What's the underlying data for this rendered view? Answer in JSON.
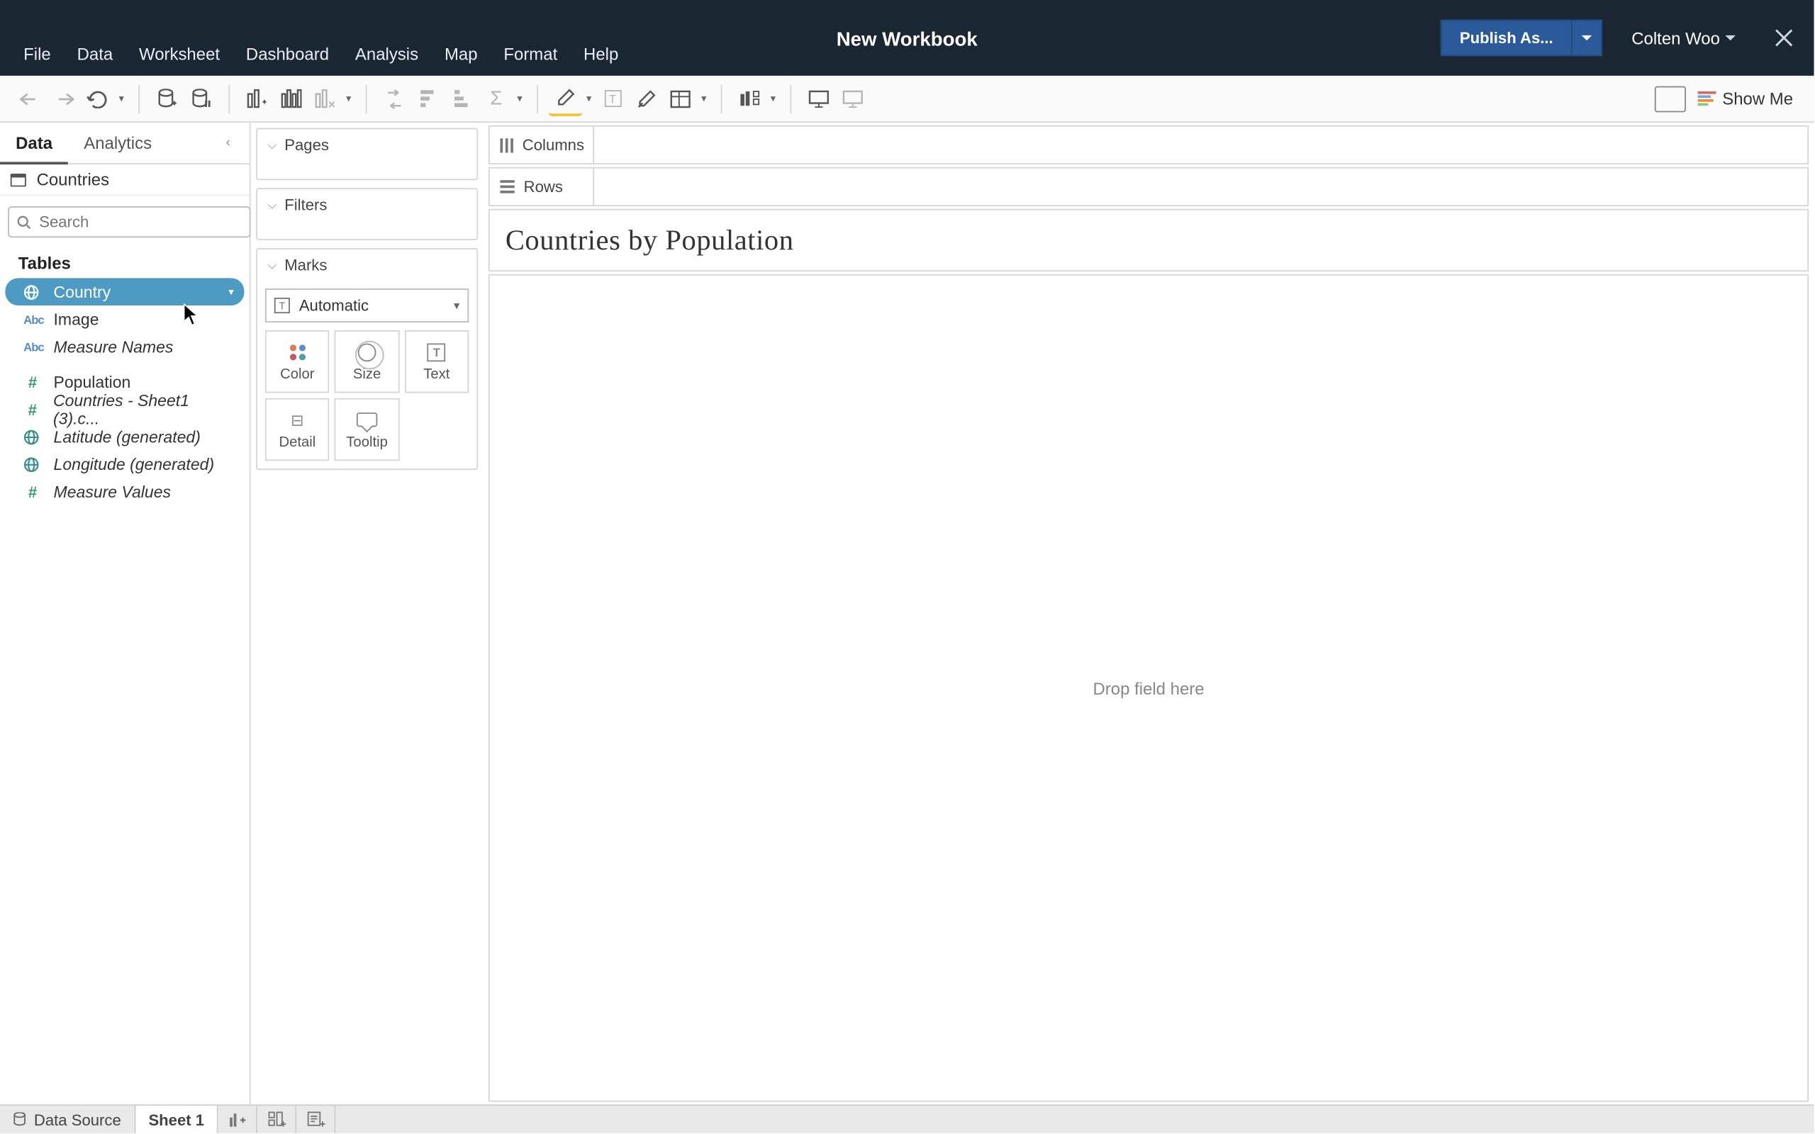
{
  "titlebar": {
    "title": "New Workbook",
    "publish_label": "Publish As...",
    "user": "Colten Woo"
  },
  "menubar": [
    "File",
    "Data",
    "Worksheet",
    "Dashboard",
    "Analysis",
    "Map",
    "Format",
    "Help"
  ],
  "toolbar": {
    "showme": "Show Me"
  },
  "datapane": {
    "tabs": {
      "data": "Data",
      "analytics": "Analytics"
    },
    "datasource": "Countries",
    "search_placeholder": "Search",
    "tables_header": "Tables",
    "fields": [
      {
        "icon": "globe",
        "label": "Country",
        "selected": true,
        "italic": false,
        "section": "dim"
      },
      {
        "icon": "abc",
        "label": "Image",
        "selected": false,
        "italic": false,
        "section": "dim"
      },
      {
        "icon": "abc",
        "label": "Measure Names",
        "selected": false,
        "italic": true,
        "section": "dim"
      },
      {
        "icon": "hash",
        "label": "Population",
        "selected": false,
        "italic": false,
        "section": "meas"
      },
      {
        "icon": "hash",
        "label": "Countries - Sheet1 (3).c...",
        "selected": false,
        "italic": true,
        "section": "meas"
      },
      {
        "icon": "globe",
        "label": "Latitude (generated)",
        "selected": false,
        "italic": true,
        "section": "meas"
      },
      {
        "icon": "globe",
        "label": "Longitude (generated)",
        "selected": false,
        "italic": true,
        "section": "meas"
      },
      {
        "icon": "hash",
        "label": "Measure Values",
        "selected": false,
        "italic": true,
        "section": "meas"
      }
    ]
  },
  "shelves": {
    "pages": "Pages",
    "filters": "Filters",
    "marks": "Marks",
    "marks_type": "Automatic",
    "cells": {
      "color": "Color",
      "size": "Size",
      "text": "Text",
      "detail": "Detail",
      "tooltip": "Tooltip"
    }
  },
  "canvas": {
    "columns": "Columns",
    "rows": "Rows",
    "viz_title": "Countries by Population",
    "drop_hint": "Drop field here"
  },
  "bottom": {
    "datasource": "Data Source",
    "sheet": "Sheet 1"
  },
  "colors": {
    "accent": "#2a5a99",
    "field_selected": "#4d9bc3",
    "dim_blue": "#5a8bc4",
    "meas_green": "#3a9a6f",
    "geo_teal": "#3a8f8f"
  }
}
